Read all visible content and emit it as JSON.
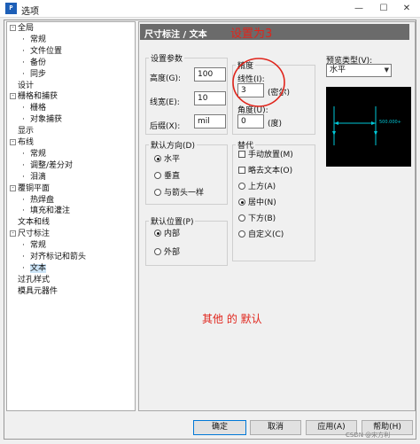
{
  "window": {
    "title": "选项",
    "min": "—",
    "max": "☐",
    "close": "✕"
  },
  "tree": [
    {
      "label": "全局",
      "toggle": "-",
      "indent": 0
    },
    {
      "label": "常规",
      "indent": 1
    },
    {
      "label": "文件位置",
      "indent": 1
    },
    {
      "label": "备份",
      "indent": 1
    },
    {
      "label": "同步",
      "indent": 1
    },
    {
      "label": "设计",
      "indent": 0
    },
    {
      "label": "栅格和捕获",
      "toggle": "-",
      "indent": 0
    },
    {
      "label": "栅格",
      "indent": 1
    },
    {
      "label": "对象捕获",
      "indent": 1
    },
    {
      "label": "显示",
      "indent": 0
    },
    {
      "label": "布线",
      "toggle": "-",
      "indent": 0
    },
    {
      "label": "常规",
      "indent": 1
    },
    {
      "label": "调整/差分对",
      "indent": 1
    },
    {
      "label": "泪滴",
      "indent": 1
    },
    {
      "label": "覆铜平面",
      "toggle": "-",
      "indent": 0
    },
    {
      "label": "热焊盘",
      "indent": 1
    },
    {
      "label": "填充和灌注",
      "indent": 1
    },
    {
      "label": "文本和线",
      "indent": 0
    },
    {
      "label": "尺寸标注",
      "toggle": "-",
      "indent": 0
    },
    {
      "label": "常规",
      "indent": 1
    },
    {
      "label": "对齐标记和箭头",
      "indent": 1
    },
    {
      "label": "文本",
      "indent": 1,
      "selected": true
    },
    {
      "label": "过孔样式",
      "indent": 0
    },
    {
      "label": "模具元器件",
      "indent": 0
    }
  ],
  "panel": {
    "header": "尺寸标注 / 文本",
    "annotation_top": "设置为3",
    "annotation_bottom": "其他 的 默认",
    "settings": {
      "legend": "设置参数",
      "height_label": "高度(G):",
      "height_value": "100",
      "linewidth_label": "线宽(E):",
      "linewidth_value": "10",
      "mirror_label": "后缀(X):",
      "mirror_value": "mil"
    },
    "precision": {
      "legend": "精度",
      "linear_label": "线性(I):",
      "linear_value": "3",
      "linear_unit": "(密尔)",
      "angle_label": "角度(U):",
      "angle_value": "0",
      "angle_unit": "(度)"
    },
    "default_direction": {
      "legend": "默认方向(D)",
      "options": [
        "水平",
        "垂直",
        "与箭头一样"
      ],
      "selected": 0
    },
    "default_position": {
      "legend": "默认位置(P)",
      "options": [
        "内部",
        "外部"
      ],
      "selected": 0
    },
    "override": {
      "legend": "替代",
      "checks": [
        "手动放置(M)",
        "略去文本(O)"
      ],
      "radios": [
        "上方(A)",
        "居中(N)",
        "下方(B)",
        "自定义(C)"
      ],
      "selected": 1
    },
    "preview": {
      "label": "预览类型(V):",
      "value": "水平",
      "dim_text": "500.000+"
    }
  },
  "buttons": {
    "ok": "确定",
    "cancel": "取消",
    "apply": "应用(A)",
    "help": "帮助(H)"
  },
  "watermark": "CSDN @宋方利",
  "colors": {
    "header": "#6b6b6b",
    "annotation": "#e0241b",
    "preview_line": "#00c8d8"
  }
}
